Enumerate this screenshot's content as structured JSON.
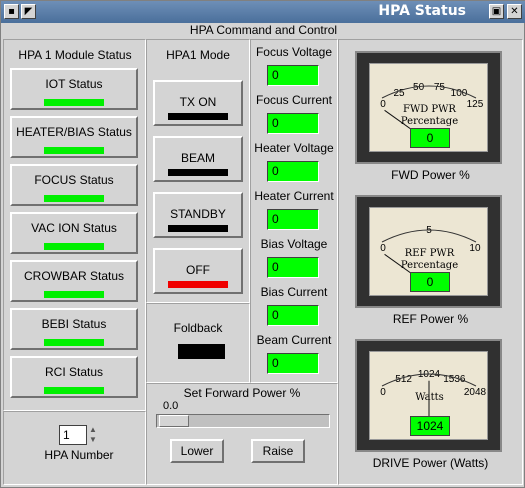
{
  "window": {
    "title": "HPA Status",
    "app_header": "HPA Command and Control",
    "menu_icon": "menu-icon",
    "arrow_icon": "back-arrow-icon"
  },
  "module_status": {
    "title": "HPA 1 Module Status",
    "items": [
      {
        "label": "IOT Status",
        "state": "ok"
      },
      {
        "label": "HEATER/BIAS Status",
        "state": "ok"
      },
      {
        "label": "FOCUS Status",
        "state": "ok"
      },
      {
        "label": "VAC ION Status",
        "state": "ok"
      },
      {
        "label": "CROWBAR Status",
        "state": "ok"
      },
      {
        "label": "BEBI Status",
        "state": "ok"
      },
      {
        "label": "RCI Status",
        "state": "ok"
      }
    ]
  },
  "hpa_number": {
    "label": "HPA Number",
    "value": "1"
  },
  "mode": {
    "title": "HPA1 Mode",
    "items": [
      {
        "label": "TX ON",
        "indicator": "#000000"
      },
      {
        "label": "BEAM",
        "indicator": "#000000"
      },
      {
        "label": "STANDBY",
        "indicator": "#000000"
      },
      {
        "label": "OFF",
        "indicator": "#f00000"
      }
    ],
    "foldback_label": "Foldback"
  },
  "readings": [
    {
      "label": "Focus Voltage",
      "value": "0"
    },
    {
      "label": "Focus Current",
      "value": "0"
    },
    {
      "label": "Heater Voltage",
      "value": "0"
    },
    {
      "label": "Heater Current",
      "value": "0"
    },
    {
      "label": "Bias Voltage",
      "value": "0"
    },
    {
      "label": "Bias Current",
      "value": "0"
    },
    {
      "label": "Beam Current",
      "value": "0"
    }
  ],
  "forward_power": {
    "title": "Set Forward Power %",
    "value": "0.0",
    "lower_label": "Lower",
    "raise_label": "Raise"
  },
  "meters": [
    {
      "caption": "FWD Power %",
      "face_line1": "FWD PWR",
      "face_line2": "Percentage",
      "ticks": [
        "0",
        "25",
        "50",
        "75",
        "100",
        "125"
      ],
      "value": "0"
    },
    {
      "caption": "REF Power %",
      "face_line1": "REF PWR",
      "face_line2": "Percentage",
      "ticks": [
        "0",
        "5",
        "10"
      ],
      "value": "0"
    },
    {
      "caption": "DRIVE Power (Watts)",
      "face_line1": "Watts",
      "face_line2": "",
      "ticks": [
        "0",
        "512",
        "1024",
        "1536",
        "2048"
      ],
      "value": "1024"
    }
  ]
}
